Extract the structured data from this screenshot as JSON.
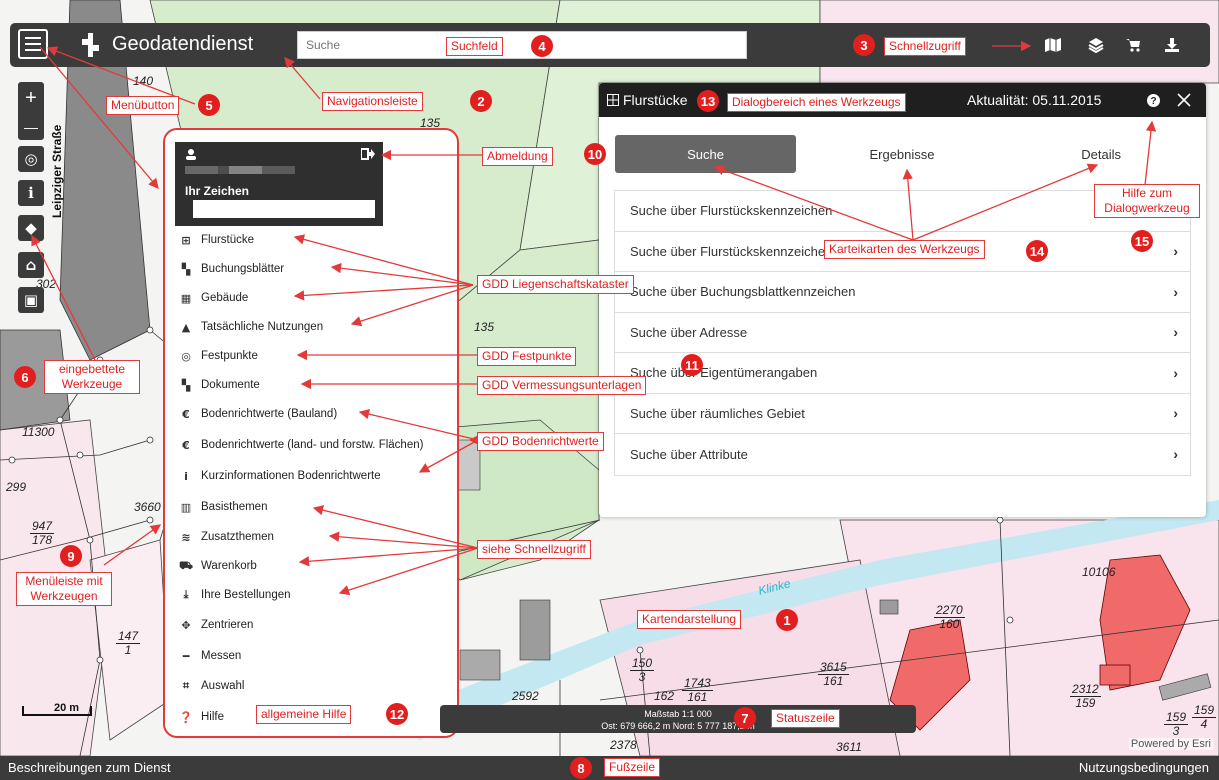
{
  "navbar": {
    "title": "Geodatendienst",
    "search_placeholder": "Suche",
    "quick_access": [
      "map-icon",
      "layers-icon",
      "cart-icon",
      "download-icon"
    ]
  },
  "tools": {
    "zoom_in": "+",
    "zoom_out": "—",
    "items": [
      "target-icon",
      "info-icon",
      "eraser-icon",
      "home-icon",
      "save-icon"
    ]
  },
  "map": {
    "street": "Leipziger Straße",
    "river": "Klinke",
    "scale_label": "20 m",
    "attribution": "Powered by Esri",
    "parcel_numbers": [
      "140",
      "135",
      "302",
      "135",
      "11300",
      "299",
      "3660",
      "10106",
      "2592",
      "162",
      "2378",
      "3611"
    ],
    "fractions": [
      {
        "top": "947",
        "bot": "178"
      },
      {
        "top": "147",
        "bot": "1"
      },
      {
        "top": "150",
        "bot": "3"
      },
      {
        "top": "1743",
        "bot": "161"
      },
      {
        "top": "2270",
        "bot": "160"
      },
      {
        "top": "3615",
        "bot": "161"
      },
      {
        "top": "2312",
        "bot": "159"
      },
      {
        "top": "159",
        "bot": "3"
      },
      {
        "top": "159",
        "bot": "4"
      }
    ]
  },
  "side_menu": {
    "zeichen_label": "Ihr Zeichen",
    "items": [
      {
        "icon": "⊞",
        "label": "Flurstücke"
      },
      {
        "icon": "▚",
        "label": "Buchungsblätter"
      },
      {
        "icon": "▦",
        "label": "Gebäude"
      },
      {
        "icon": "▲",
        "label": "Tatsächliche Nutzungen"
      },
      {
        "icon": "◎",
        "label": "Festpunkte"
      },
      {
        "icon": "▚",
        "label": "Dokumente"
      },
      {
        "icon": "€",
        "label": "Bodenrichtwerte (Bauland)"
      },
      {
        "icon": "€",
        "label": "Bodenrichtwerte (land- und forstw. Flächen)"
      },
      {
        "icon": "i",
        "label": "Kurzinformationen Bodenrichtwerte"
      },
      {
        "icon": "▥",
        "label": "Basisthemen"
      },
      {
        "icon": "≋",
        "label": "Zusatzthemen"
      },
      {
        "icon": "⛟",
        "label": "Warenkorb"
      },
      {
        "icon": "⤓",
        "label": "Ihre Bestellungen"
      },
      {
        "icon": "✥",
        "label": "Zentrieren"
      },
      {
        "icon": "━",
        "label": "Messen"
      },
      {
        "icon": "⌗",
        "label": "Auswahl"
      },
      {
        "icon": "❓",
        "label": "Hilfe"
      }
    ]
  },
  "dialog": {
    "title": "Flurstücke",
    "aktualitaet": "Aktualität: 05.11.2015",
    "tabs": [
      "Suche",
      "Ergebnisse",
      "Details"
    ],
    "rows": [
      "Suche über Flurstückskennzeichen",
      "Suche über Flurstückskennzeichen",
      "Suche über Buchungsblattkennzeichen",
      "Suche über Adresse",
      "Suche über Eigentümerangaben",
      "Suche über räumliches Gebiet",
      "Suche über Attribute"
    ]
  },
  "statusbar": {
    "scale": "Maßstab 1:1 000",
    "coords": "Ost: 679 666,2 m Nord: 5 777 187,2 m"
  },
  "footer": {
    "left": "Beschreibungen zum Dienst",
    "right": "Nutzungsbedingungen"
  },
  "annotations": {
    "labels": [
      "Suchfeld",
      "Schnellzugriff",
      "Menübutton",
      "Navigationsleiste",
      "Dialogbereich eines Werkzeugs",
      "Abmeldung",
      "Hilfe zum Dialogwerkzeug",
      "Karteikarten des Werkzeugs",
      "GDD Liegenschaftskataster",
      "GDD Festpunkte",
      "GDD Vermessungsunterlagen",
      "GDD Bodenrichtwerte",
      "siehe Schnellzugriff",
      "eingebettete Werkzeuge",
      "Menüleiste mit Werkzeugen",
      "Kartendarstellung",
      "allgemeine Hilfe",
      "Statuszeile",
      "Fußzeile"
    ],
    "numbers": [
      "1",
      "2",
      "3",
      "4",
      "5",
      "6",
      "7",
      "8",
      "9",
      "10",
      "11",
      "12",
      "13",
      "14",
      "15"
    ]
  },
  "colors": {
    "annotation": "#e23a3a",
    "bar": "#3b3b3b",
    "parcel_pink": "#f8e3ec",
    "parcel_green": "#d9efd2",
    "building": "#f26d6d",
    "river": "#bfe7f0"
  }
}
